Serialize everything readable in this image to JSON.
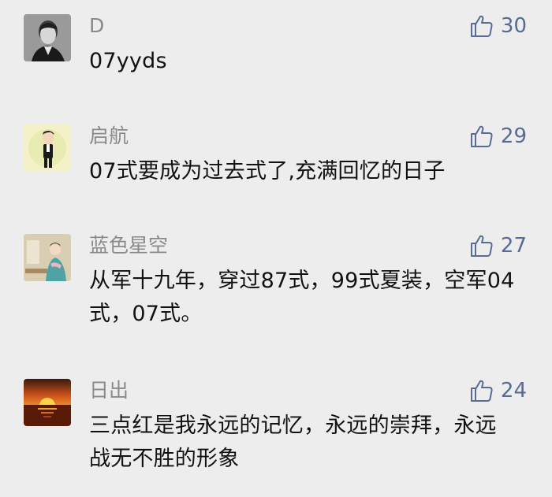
{
  "comments": [
    {
      "username": "D",
      "text": "07yyds",
      "likes": "30",
      "avatar_icon": "portrait-photo-icon"
    },
    {
      "username": "启航",
      "text": "07式要成为过去式了,充满回忆的日子",
      "likes": "29",
      "avatar_icon": "cartoon-man-avatar-icon"
    },
    {
      "username": "蓝色星空",
      "text": "从军十九年，穿过87式，99式夏装，空军04式，07式。",
      "likes": "27",
      "avatar_icon": "painted-lady-avatar-icon"
    },
    {
      "username": "日出",
      "text": "三点红是我永远的记忆，永远的崇拜，永远战无不胜的形象",
      "likes": "24",
      "avatar_icon": "sunset-avatar-icon"
    }
  ],
  "like_icon": "thumbs-up-icon",
  "colors": {
    "background": "#ededed",
    "username": "#8a8a8a",
    "text": "#111111",
    "like": "#576b95"
  }
}
